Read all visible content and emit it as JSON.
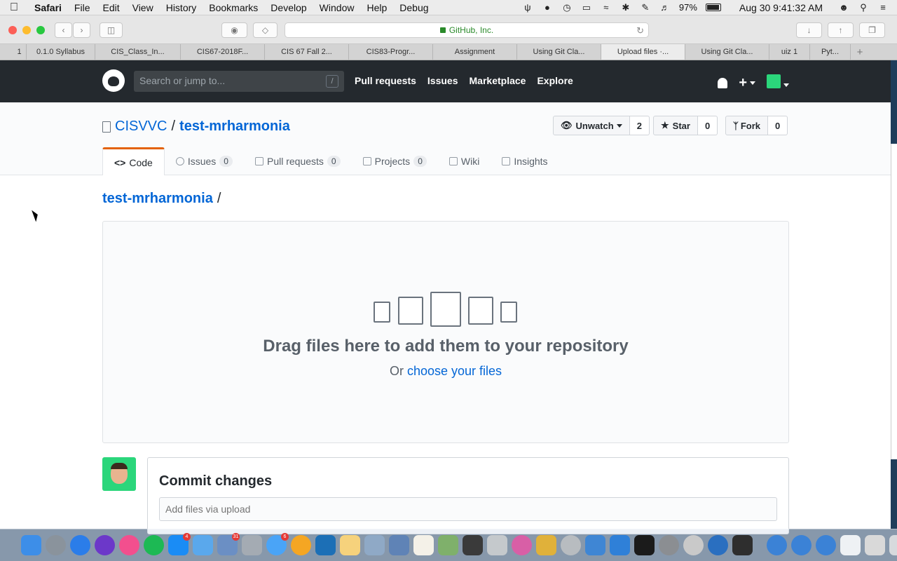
{
  "menubar": {
    "app_name": "Safari",
    "items": [
      "File",
      "Edit",
      "View",
      "History",
      "Bookmarks",
      "Develop",
      "Window",
      "Help",
      "Debug"
    ],
    "battery": "97%",
    "clock": "Aug 30  9:41:32 AM"
  },
  "browser": {
    "url_label": "GitHub, Inc.",
    "tabs": [
      "1",
      "0.1.0 Syllabus",
      "CIS_Class_In...",
      "CIS67-2018F...",
      "CIS 67 Fall 2...",
      "CIS83-Progr...",
      "Assignment",
      "Using Git Cla...",
      "Upload files ·...",
      "Using Git Cla...",
      "uiz 1",
      "Pyt..."
    ],
    "active_tab_index": 8
  },
  "github": {
    "search_placeholder": "Search or jump to...",
    "search_shortcut": "/",
    "nav": [
      "Pull requests",
      "Issues",
      "Marketplace",
      "Explore"
    ],
    "plus": "+",
    "owner": "CISVVC",
    "repo_sep": "/",
    "repo": "test-mrharmonia",
    "watch": {
      "label": "Unwatch",
      "count": "2"
    },
    "star": {
      "label": "Star",
      "count": "0"
    },
    "fork": {
      "label": "Fork",
      "count": "0"
    },
    "tabs": [
      {
        "label": "Code",
        "icon": "<>",
        "count": null
      },
      {
        "label": "Issues",
        "count": "0"
      },
      {
        "label": "Pull requests",
        "count": "0"
      },
      {
        "label": "Projects",
        "count": "0"
      },
      {
        "label": "Wiki",
        "count": null
      },
      {
        "label": "Insights",
        "count": null
      }
    ],
    "breadcrumb": "test-mrharmonia",
    "breadcrumb_sep": "/",
    "dropzone": {
      "title": "Drag files here to add them to your repository",
      "or_text": "Or",
      "choose_link": "choose your files"
    },
    "commit": {
      "title": "Commit changes",
      "placeholder": "Add files via upload"
    }
  },
  "dock": {
    "badges": {
      "appstore": "4",
      "calendar": "31",
      "messages": "6"
    }
  },
  "colors": {
    "header_bg": "#24292e",
    "link": "#0366d6",
    "code_tab_accent": "#e36209",
    "avatar_bg": "#2bd67b"
  }
}
